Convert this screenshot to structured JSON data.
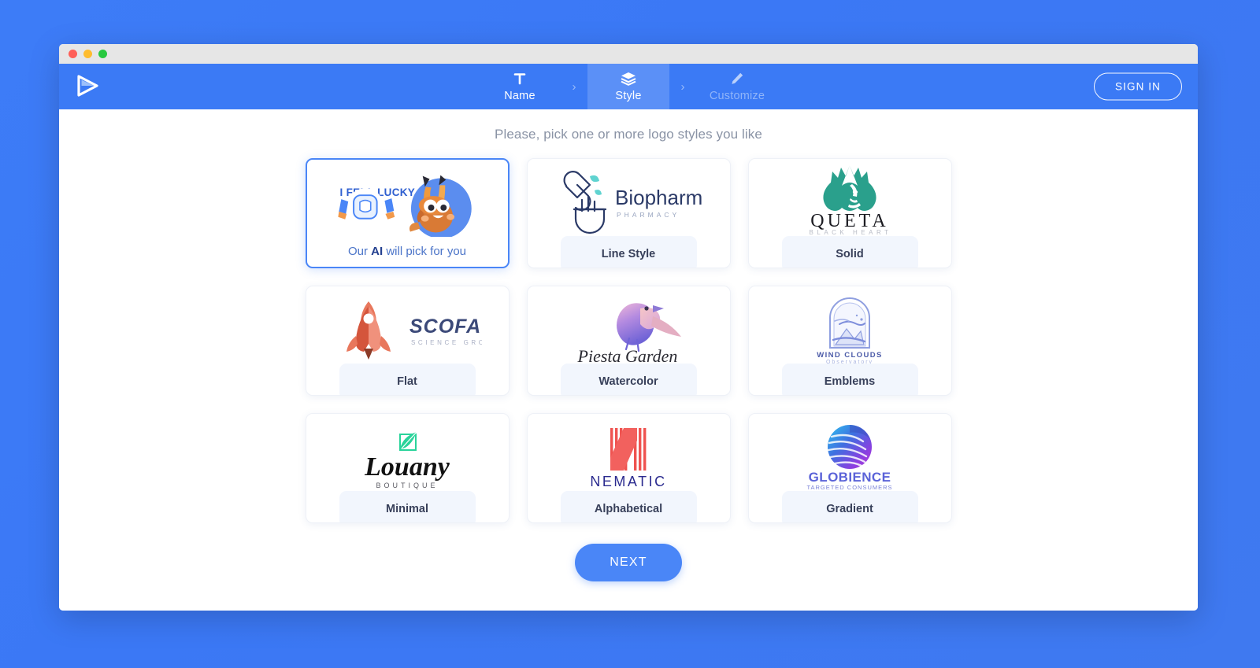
{
  "window": {
    "traffic_lights": [
      "close",
      "minimize",
      "maximize"
    ],
    "brand_icon": "play-triangle-logo"
  },
  "header": {
    "steps": [
      {
        "label": "Name",
        "icon": "text-t-icon",
        "state": "done"
      },
      {
        "label": "Style",
        "icon": "layers-icon",
        "state": "active"
      },
      {
        "label": "Customize",
        "icon": "pencil-icon",
        "state": "disabled"
      }
    ],
    "separator": "›",
    "sign_in_label": "SIGN IN",
    "accent_color": "#3b7af5",
    "active_step_color": "#5b90f7"
  },
  "main": {
    "prompt": "Please, pick one or more logo styles you like",
    "lucky_card": {
      "title": "I FEEL LUCKY !",
      "footer_prefix": "Our ",
      "footer_bold": "AI",
      "footer_suffix": " will pick for you",
      "selected": true,
      "art": "mascot-dog-with-robot-icon"
    },
    "styles": [
      {
        "label": "Line Style",
        "logo_name": "Biopharm",
        "logo_tagline": "PHARMACY",
        "logo_icon": "capsule-mortar-line-icon",
        "color": "#2b3a67"
      },
      {
        "label": "Solid",
        "logo_name": "QUETA",
        "logo_tagline": "BLACK HEART",
        "logo_icon": "queen-spade-solid-icon",
        "color": "#2aa08c"
      },
      {
        "label": "Flat",
        "logo_name": "SCOFA",
        "logo_tagline": "SCIENCE GROUP",
        "logo_icon": "rocket-flat-icon",
        "color": "#3c4a79"
      },
      {
        "label": "Watercolor",
        "logo_name": "Piesta Garden",
        "logo_tagline": "",
        "logo_icon": "watercolor-bird-icon",
        "color": "#9a7ad1"
      },
      {
        "label": "Emblems",
        "logo_name": "WIND CLOUDS",
        "logo_tagline": "Observatory",
        "logo_icon": "arch-mountain-emblem-icon",
        "color": "#7d8ddb"
      },
      {
        "label": "Minimal",
        "logo_name": "Louany",
        "logo_tagline": "BOUTIQUE",
        "logo_icon": "green-leaf-icon",
        "color": "#111111"
      },
      {
        "label": "Alphabetical",
        "logo_name": "NEMATIC",
        "logo_tagline": "",
        "logo_icon": "striped-n-monogram-icon",
        "color": "#2b2b8f"
      },
      {
        "label": "Gradient",
        "logo_name": "GLOBIENCE",
        "logo_tagline": "TARGETED CONSUMERS",
        "logo_icon": "gradient-globe-icon",
        "color": "#5b63d8"
      }
    ],
    "next_label": "NEXT"
  }
}
